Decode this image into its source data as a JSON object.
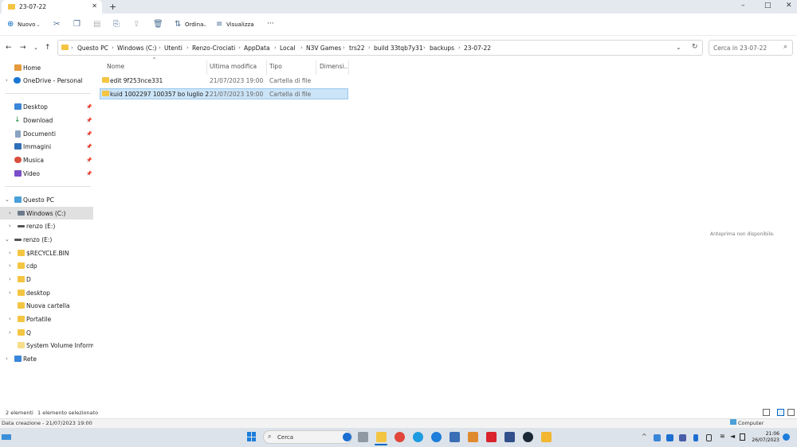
{
  "window": {
    "tab_title": "23-07-22",
    "new_tab": "+",
    "minimize": "–",
    "maximize": "□",
    "close": "✕"
  },
  "toolbar": {
    "new_label": "Nuovo",
    "sort_label": "Ordina",
    "view_label": "Visualizza",
    "more_label": "···"
  },
  "address": {
    "breadcrumbs": [
      "Questo PC",
      "Windows (C:)",
      "Utenti",
      "Renzo-Crociati",
      "AppData",
      "Local",
      "N3V Games",
      "trs22",
      "build 33tqb7y31",
      "backups",
      "23-07-22"
    ],
    "search_placeholder": "Cerca in 23-07-22"
  },
  "sidebar": {
    "items": [
      {
        "label": "Home"
      },
      {
        "label": "OneDrive - Personal"
      },
      {
        "label": "Desktop"
      },
      {
        "label": "Download"
      },
      {
        "label": "Documenti"
      },
      {
        "label": "Immagini"
      },
      {
        "label": "Musica"
      },
      {
        "label": "Video"
      },
      {
        "label": "Questo PC"
      },
      {
        "label": "Windows (C:)"
      },
      {
        "label": "renzo (E:)"
      },
      {
        "label": "renzo (E:)"
      },
      {
        "label": "$RECYCLE.BIN"
      },
      {
        "label": "cdp"
      },
      {
        "label": "D"
      },
      {
        "label": "desktop"
      },
      {
        "label": "Nuova cartella"
      },
      {
        "label": "Portatile"
      },
      {
        "label": "Q"
      },
      {
        "label": "System Volume Informat"
      },
      {
        "label": "Rete"
      }
    ]
  },
  "columns": {
    "name": "Nome",
    "modified": "Ultima modifica",
    "type": "Tipo",
    "size": "Dimensi..."
  },
  "files": [
    {
      "name": "edit 9f253nce331",
      "modified": "21/07/2023 19:00",
      "type": "Cartella di file"
    },
    {
      "name": "kuid 1002297 100357 bo luglio 2",
      "modified": "21/07/2023 19:00",
      "type": "Cartella di file"
    }
  ],
  "preview": {
    "text": "Anteprima non disponibile."
  },
  "status": {
    "count": "2 elementi",
    "selected": "1 elemento selezionato",
    "created": "Data creazione - 21/07/2023 19:00",
    "computer": "Computer"
  },
  "taskbar": {
    "search_label": "Cerca",
    "time": "21:06",
    "date": "26/07/2023"
  },
  "colors": {
    "folder": "#f4c542",
    "selection": "#cce4f7",
    "accent": "#0067c0"
  }
}
